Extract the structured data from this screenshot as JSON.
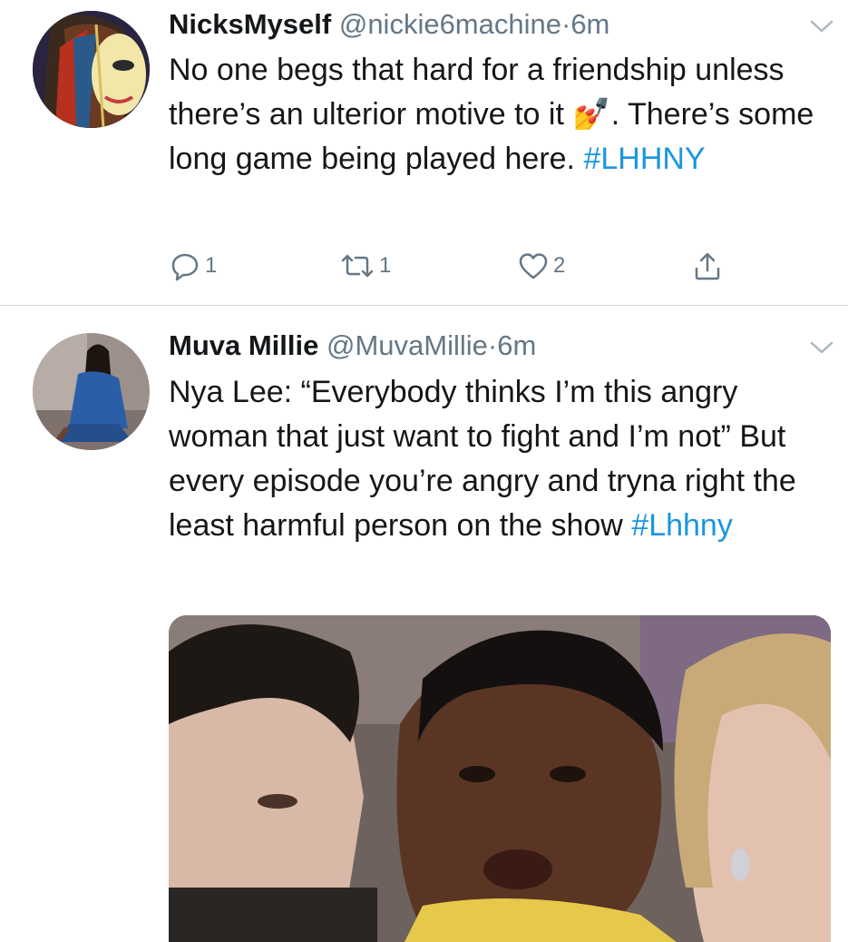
{
  "tweets": [
    {
      "display_name": "NicksMyself",
      "handle": "@nickie6machine",
      "separator": "·",
      "time": "6m",
      "text_before": "No one begs that hard for a friendship unless there’s an ulterior motive to it ",
      "emoji": "💅",
      "text_after": ". There’s some long game being played here. ",
      "hashtag": "#LHHNY",
      "actions": {
        "reply_count": "1",
        "retweet_count": "1",
        "like_count": "2"
      }
    },
    {
      "display_name": "Muva Millie",
      "handle": "@MuvaMillie",
      "separator": "·",
      "time": "6m",
      "text": "Nya Lee: “Everybody thinks I’m this angry woman that just want to fight and I’m not” But every episode you’re angry and tryna right the least harmful person on the show ",
      "hashtag": "#Lhhny"
    }
  ],
  "colors": {
    "link": "#1b95e0",
    "secondary_text": "#657786",
    "divider": "#d3d8dc"
  }
}
